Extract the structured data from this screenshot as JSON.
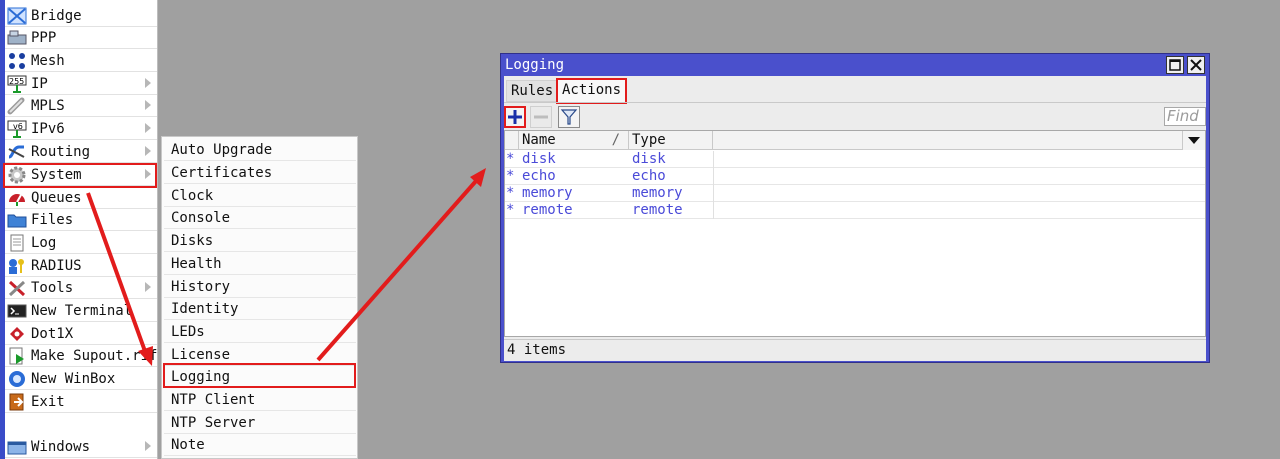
{
  "left_menu": {
    "items": [
      {
        "label": "Bridge",
        "icon": "bridge-icon",
        "submenu": false
      },
      {
        "label": "PPP",
        "icon": "ppp-icon",
        "submenu": false
      },
      {
        "label": "Mesh",
        "icon": "mesh-icon",
        "submenu": false
      },
      {
        "label": "IP",
        "icon": "ip-icon",
        "submenu": true
      },
      {
        "label": "MPLS",
        "icon": "mpls-icon",
        "submenu": true
      },
      {
        "label": "IPv6",
        "icon": "ipv6-icon",
        "submenu": true
      },
      {
        "label": "Routing",
        "icon": "routing-icon",
        "submenu": true
      },
      {
        "label": "System",
        "icon": "gear-icon",
        "submenu": true
      },
      {
        "label": "Queues",
        "icon": "queues-icon",
        "submenu": false
      },
      {
        "label": "Files",
        "icon": "folder-icon",
        "submenu": false
      },
      {
        "label": "Log",
        "icon": "log-icon",
        "submenu": false
      },
      {
        "label": "RADIUS",
        "icon": "radius-icon",
        "submenu": false
      },
      {
        "label": "Tools",
        "icon": "tools-icon",
        "submenu": true
      },
      {
        "label": "New Terminal",
        "icon": "terminal-icon",
        "submenu": false
      },
      {
        "label": "Dot1X",
        "icon": "dot1x-icon",
        "submenu": false
      },
      {
        "label": "Make Supout.rif",
        "icon": "supout-icon",
        "submenu": false
      },
      {
        "label": "New WinBox",
        "icon": "winbox-icon",
        "submenu": false
      },
      {
        "label": "Exit",
        "icon": "exit-icon",
        "submenu": false
      },
      {
        "label": "Windows",
        "icon": "windows-icon",
        "submenu": true
      }
    ],
    "highlighted": "System"
  },
  "system_submenu": {
    "items": [
      "Auto Upgrade",
      "Certificates",
      "Clock",
      "Console",
      "Disks",
      "Health",
      "History",
      "Identity",
      "LEDs",
      "License",
      "Logging",
      "NTP Client",
      "NTP Server",
      "Note"
    ],
    "highlighted": "Logging"
  },
  "logging_window": {
    "title": "Logging",
    "tabs": [
      "Rules",
      "Actions"
    ],
    "active_tab": "Actions",
    "toolbar": {
      "add_icon": "plus-icon",
      "remove_icon": "minus-icon",
      "filter_icon": "filter-icon",
      "find_placeholder": "Find"
    },
    "columns": [
      "Name",
      "Type"
    ],
    "sort_indicator": "/",
    "rows": [
      {
        "flag": "*",
        "name": "disk",
        "type": "disk"
      },
      {
        "flag": "*",
        "name": "echo",
        "type": "echo"
      },
      {
        "flag": "*",
        "name": "memory",
        "type": "memory"
      },
      {
        "flag": "*",
        "name": "remote",
        "type": "remote"
      }
    ],
    "status": "4 items"
  },
  "colors": {
    "highlight": "#e21c1c",
    "window_title": "#4a50cc",
    "row_text": "#4a4ad8",
    "desktop": "#a0a0a0",
    "arrow": "#e21c1c"
  }
}
